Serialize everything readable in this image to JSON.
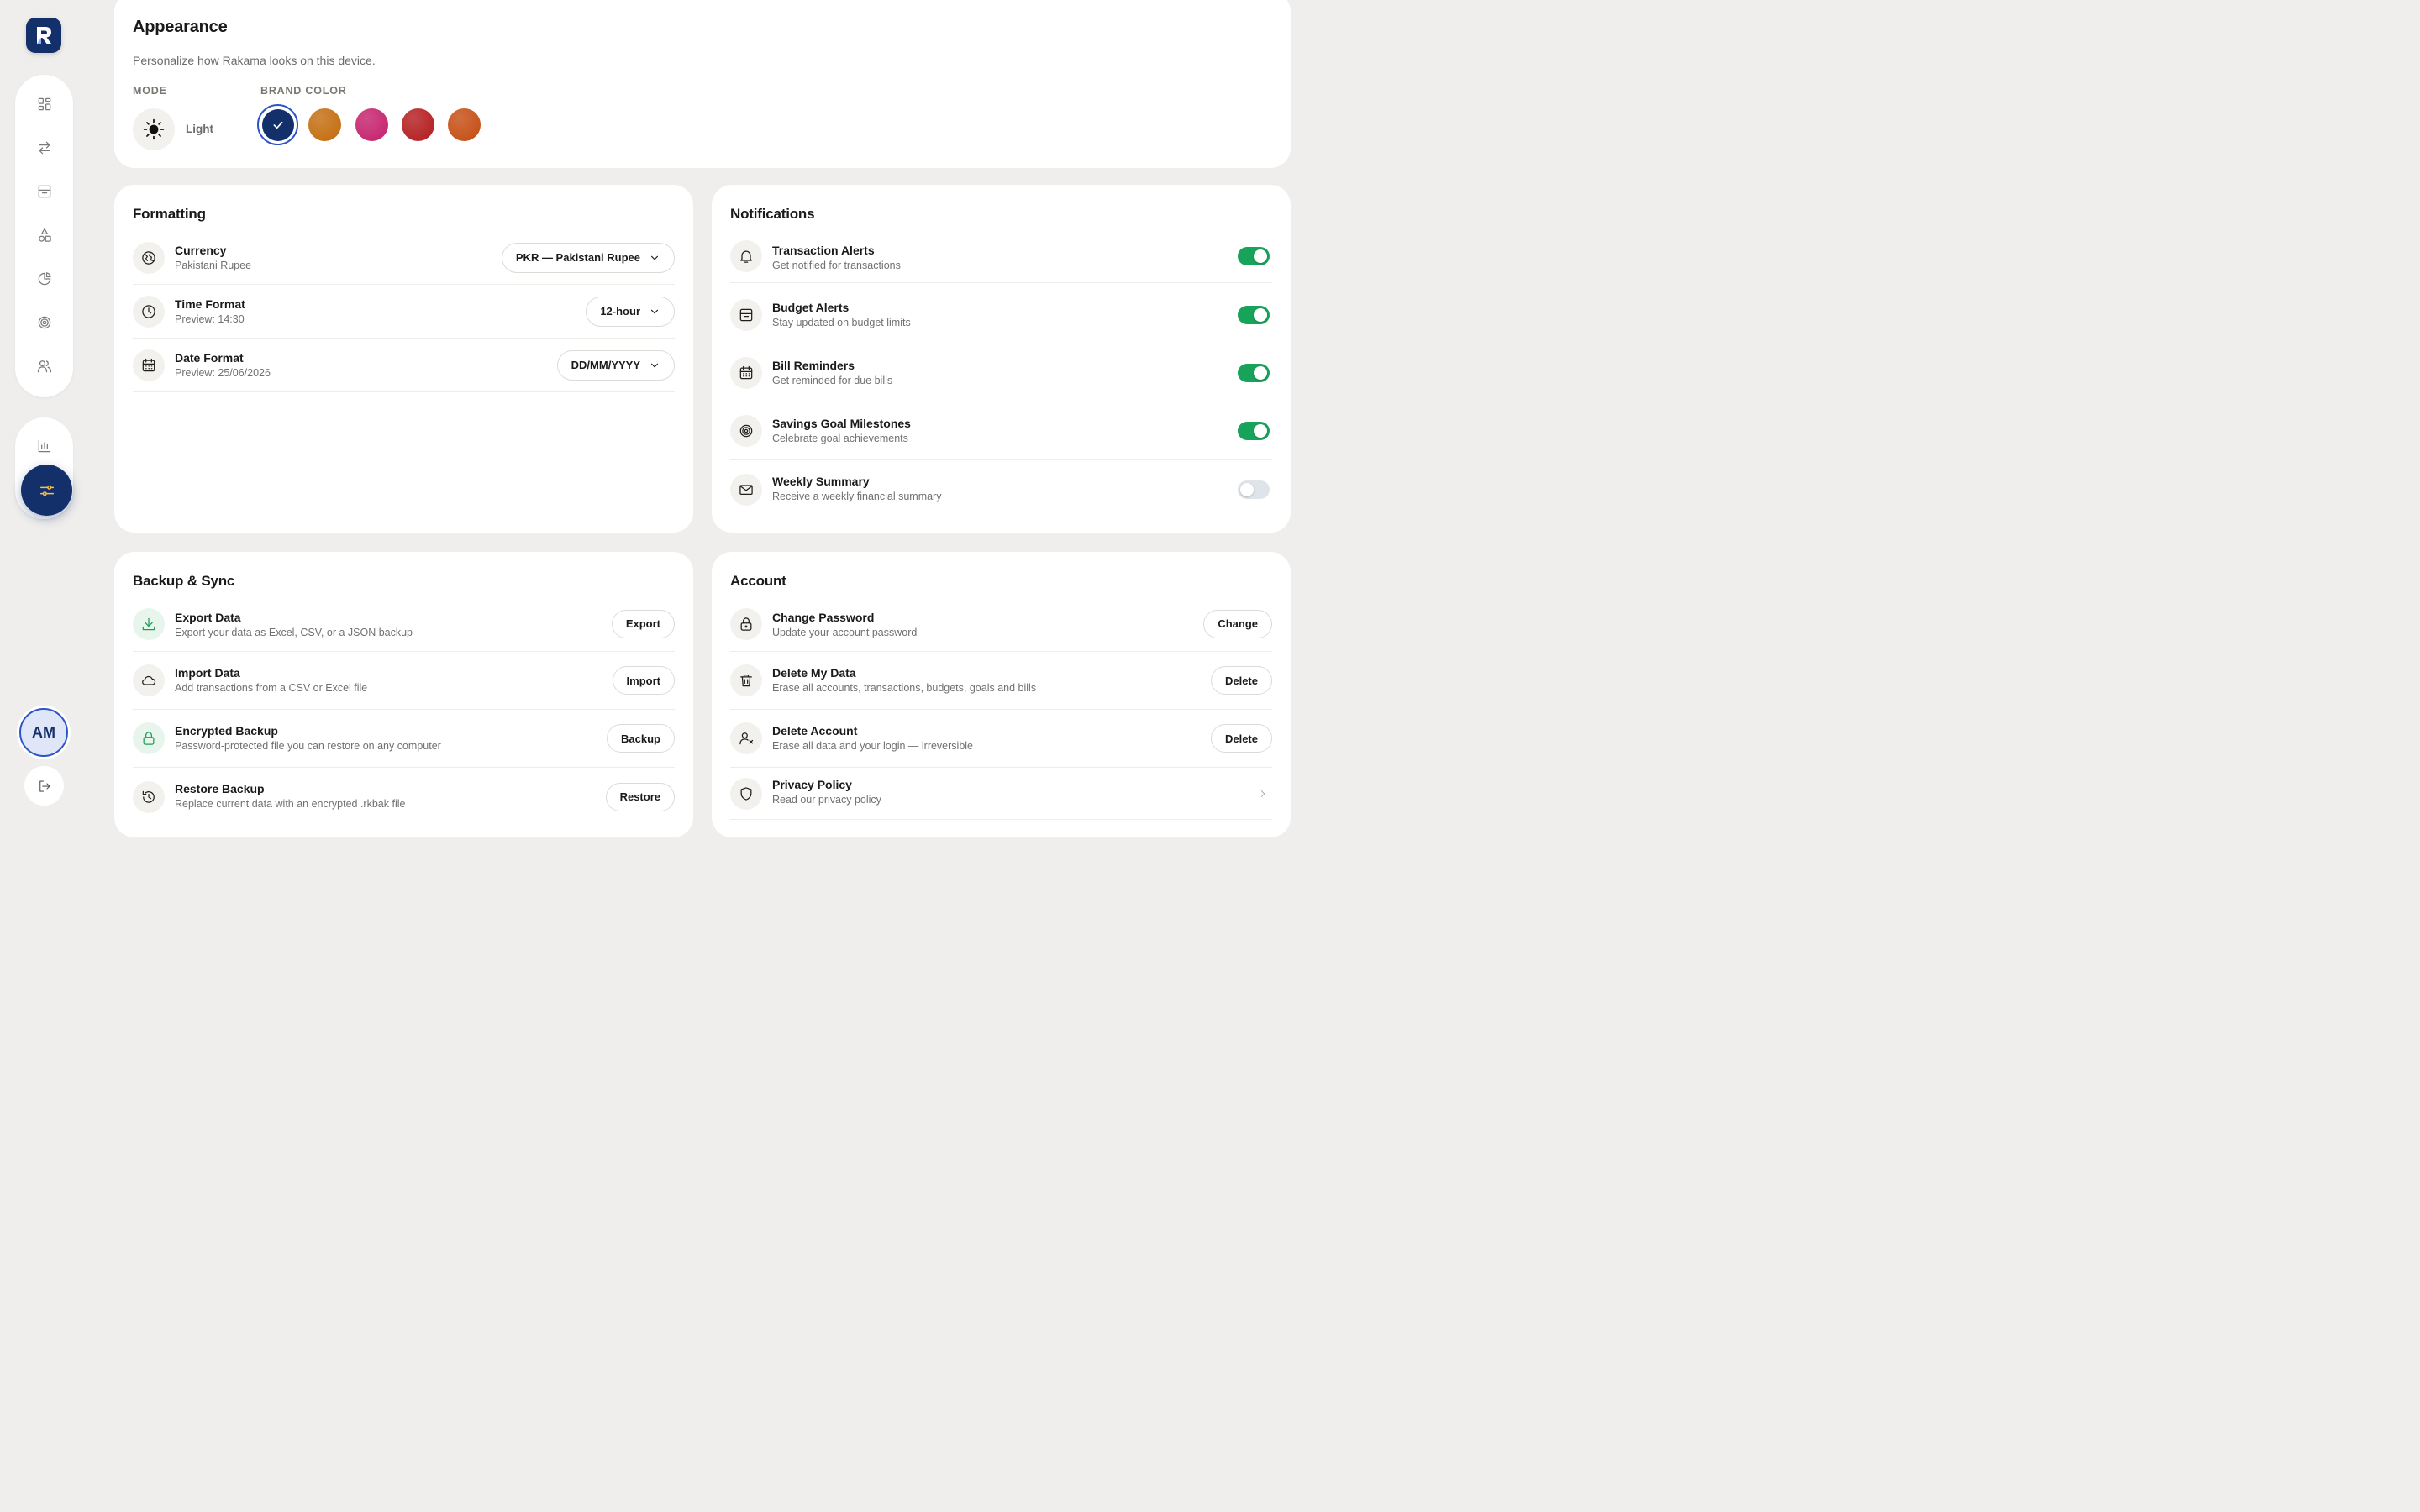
{
  "app": {
    "name": "Rakama",
    "logo_letter": "R"
  },
  "colors": {
    "brand": "#13306b",
    "accent": "#f4c14d",
    "toggle_on": "#18a35a",
    "toggle_off": "#dfe3ea",
    "selected_ring": "#2b55c7"
  },
  "nav": {
    "top_items": [
      "dashboard-icon",
      "transfer-icon",
      "budget-icon",
      "categories-icon",
      "reports-pie-icon",
      "goals-target-icon",
      "people-icon"
    ],
    "bottom_items": [
      "analytics-bar-icon",
      "settings-sliders-icon"
    ],
    "active": "settings-sliders-icon",
    "avatar_initials": "AM",
    "logout_icon": "logout-icon"
  },
  "appearance": {
    "title": "Appearance",
    "subtitle": "Personalize how Rakama looks on this device.",
    "mode_label": "MODE",
    "mode_value": "Light",
    "brand_color_label": "BRAND COLOR",
    "brand_colors": [
      "#13306b",
      "#c26a0a",
      "#c41e6a",
      "#b3191b",
      "#c44a0f"
    ],
    "selected_color_index": 0
  },
  "formatting": {
    "title": "Formatting",
    "rows": [
      {
        "title": "Currency",
        "sub": "Pakistani Rupee",
        "value": "PKR — Pakistani Rupee",
        "icon": "currency-icon"
      },
      {
        "title": "Time Format",
        "sub": "Preview: 14:30",
        "value": "12-hour",
        "icon": "clock-icon"
      },
      {
        "title": "Date Format",
        "sub": "Preview: 25/06/2026",
        "value": "DD/MM/YYYY",
        "icon": "calendar-icon"
      }
    ]
  },
  "notifications": {
    "title": "Notifications",
    "rows": [
      {
        "title": "Transaction Alerts",
        "sub": "Get notified for transactions",
        "on": true,
        "icon": "bell-icon"
      },
      {
        "title": "Budget Alerts",
        "sub": "Stay updated on budget limits",
        "on": true,
        "icon": "budget-icon"
      },
      {
        "title": "Bill Reminders",
        "sub": "Get reminded for due bills",
        "on": true,
        "icon": "calendar-icon"
      },
      {
        "title": "Savings Goal Milestones",
        "sub": "Celebrate goal achievements",
        "on": true,
        "icon": "target-icon"
      },
      {
        "title": "Weekly Summary",
        "sub": "Receive a weekly financial summary",
        "on": false,
        "icon": "mail-icon"
      }
    ]
  },
  "backup": {
    "title": "Backup & Sync",
    "rows": [
      {
        "title": "Export Data",
        "sub": "Export your data as Excel, CSV, or a JSON backup",
        "button": "Export",
        "icon": "download-icon"
      },
      {
        "title": "Import Data",
        "sub": "Add transactions from a CSV or Excel file",
        "button": "Import",
        "icon": "cloud-icon"
      },
      {
        "title": "Encrypted Backup",
        "sub": "Password-protected file you can restore on any computer",
        "button": "Backup",
        "icon": "lock-icon"
      },
      {
        "title": "Restore Backup",
        "sub": "Replace current data with an encrypted .rkbak file",
        "button": "Restore",
        "icon": "history-icon"
      }
    ]
  },
  "account": {
    "title": "Account",
    "rows": [
      {
        "title": "Change Password",
        "sub": "Update your account password",
        "button": "Change",
        "icon": "lock-icon"
      },
      {
        "title": "Delete My Data",
        "sub": "Erase all accounts, transactions, budgets, goals and bills",
        "button": "Delete",
        "icon": "trash-icon"
      },
      {
        "title": "Delete Account",
        "sub": "Erase all data and your login — irreversible",
        "button": "Delete",
        "icon": "user-remove-icon"
      },
      {
        "title": "Privacy Policy",
        "sub": "Read our privacy policy",
        "button": "",
        "icon": "shield-icon"
      }
    ]
  }
}
